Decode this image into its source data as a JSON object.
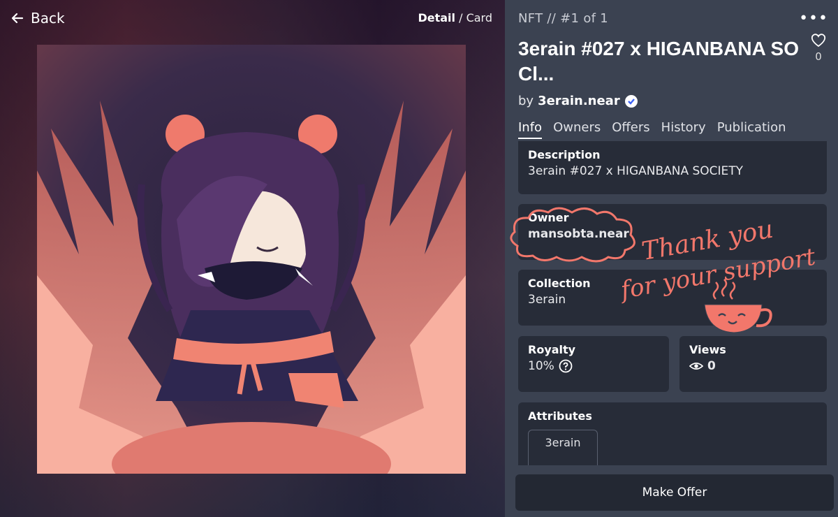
{
  "nav": {
    "back_label": "Back",
    "view_active": "Detail",
    "view_sep": "/",
    "view_other": "Card"
  },
  "nft": {
    "breadcrumb": "NFT // #1 of 1",
    "title": "3erain #027 x HIGANBANA SO Cl...",
    "by_prefix": "by",
    "creator": "3erain.near",
    "likes": "0"
  },
  "tabs": [
    "Info",
    "Owners",
    "Offers",
    "History",
    "Publication"
  ],
  "info": {
    "description_label": "Description",
    "description": "3erain #027 x HIGANBANA SOCIETY",
    "owner_label": "Owner",
    "owner": "mansobta.near",
    "collection_label": "Collection",
    "collection": "3erain",
    "royalty_label": "Royalty",
    "royalty": "10%",
    "views_label": "Views",
    "views": "0",
    "attributes_label": "Attributes",
    "attribute_chip": "3erain"
  },
  "actions": {
    "make_offer": "Make Offer"
  },
  "overlay": {
    "line1": "Thank you",
    "line2": "for your support"
  },
  "colors": {
    "accent_handwriting": "#f2776b",
    "panel_bg": "#3b4251",
    "card_bg": "#272c38",
    "verified": "#3d62f5"
  },
  "icons": [
    "arrow-left-icon",
    "more-dots-icon",
    "heart-icon",
    "verified-badge-icon",
    "question-circle-icon",
    "eye-icon",
    "coffee-cup-icon"
  ]
}
